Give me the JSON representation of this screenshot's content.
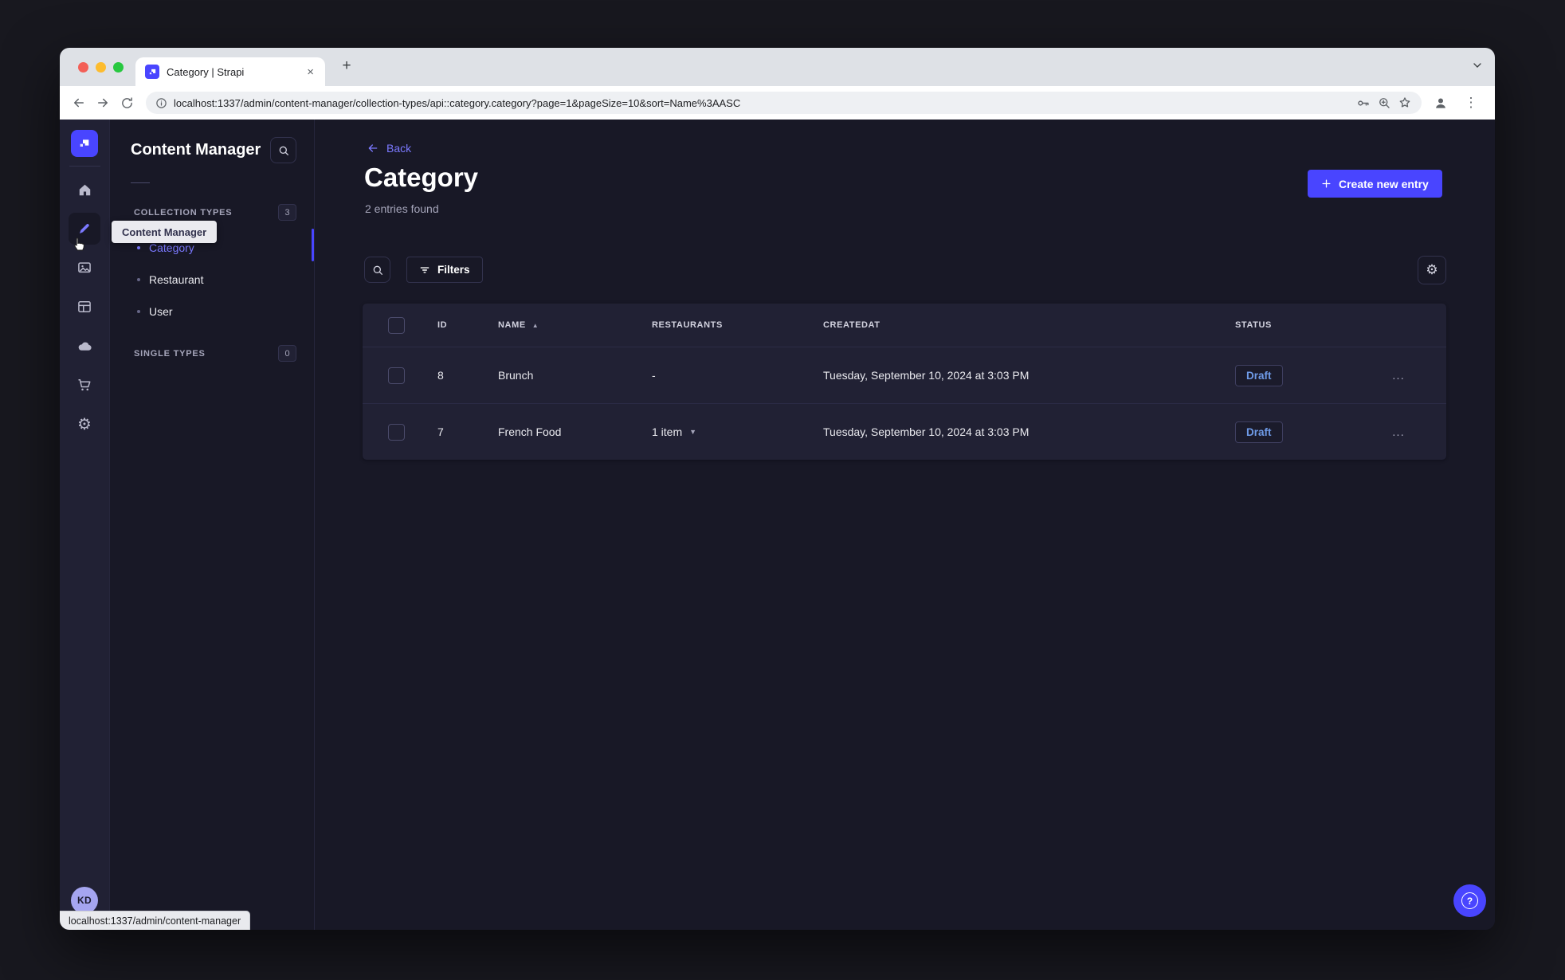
{
  "browser": {
    "tab_title": "Category | Strapi",
    "url": "localhost:1337/admin/content-manager/collection-types/api::category.category?page=1&pageSize=10&sort=Name%3AASC",
    "status_bar": "localhost:1337/admin/content-manager"
  },
  "icons": {
    "close": "×",
    "new_tab": "+",
    "dots_vertical": "⋮",
    "gear": "⚙",
    "sort_asc": "▲",
    "caret_down": "▼",
    "row_menu": "...",
    "question": "?",
    "plus": "+"
  },
  "colors": {
    "primary": "#4945ff",
    "link": "#7b79ff",
    "draft_status": "#6f9be8",
    "page_bg": "#181826",
    "card_bg": "#212134"
  },
  "sidebar": {
    "avatar_initials": "KD",
    "items": [
      {
        "name": "home"
      },
      {
        "name": "content-manager",
        "active": true
      },
      {
        "name": "media-library"
      },
      {
        "name": "content-type-builder"
      },
      {
        "name": "cloud"
      },
      {
        "name": "marketplace"
      },
      {
        "name": "settings"
      }
    ]
  },
  "subnav": {
    "title": "Content Manager",
    "tooltip": "Content Manager",
    "sections": [
      {
        "label": "COLLECTION TYPES",
        "badge": "3",
        "items": [
          {
            "label": "Category",
            "active": true
          },
          {
            "label": "Restaurant"
          },
          {
            "label": "User"
          }
        ]
      },
      {
        "label": "SINGLE TYPES",
        "badge": "0",
        "items": []
      }
    ]
  },
  "main": {
    "back_label": "Back",
    "title": "Category",
    "subtitle": "2 entries found",
    "create_button_label": "Create new entry",
    "filters_label": "Filters",
    "table": {
      "columns": {
        "id": "ID",
        "name": "NAME",
        "restaurants": "RESTAURANTS",
        "createdat": "CREATEDAT",
        "status": "STATUS"
      },
      "sorted_column": "NAME",
      "rows": [
        {
          "id": "8",
          "name": "Brunch",
          "restaurants": "-",
          "created_at": "Tuesday, September 10, 2024 at 3:03 PM",
          "status": "Draft"
        },
        {
          "id": "7",
          "name": "French Food",
          "restaurants": "1 item",
          "created_at": "Tuesday, September 10, 2024 at 3:03 PM",
          "status": "Draft"
        }
      ]
    },
    "help_label": "?"
  }
}
